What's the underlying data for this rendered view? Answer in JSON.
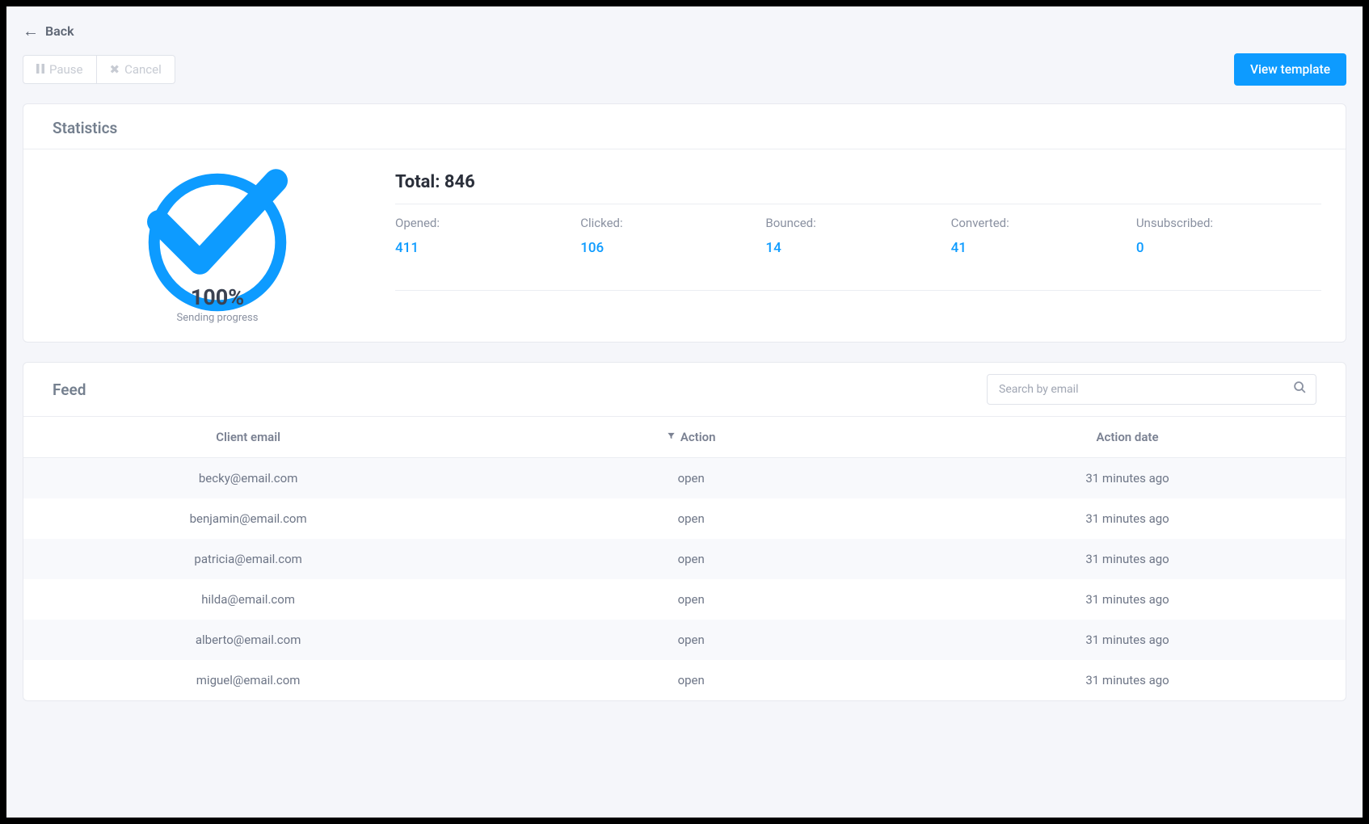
{
  "nav": {
    "back_label": "Back"
  },
  "toolbar": {
    "pause_label": "Pause",
    "cancel_label": "Cancel",
    "view_template_label": "View template"
  },
  "statistics": {
    "title": "Statistics",
    "progress_percent": "100%",
    "progress_label": "Sending progress",
    "total_label": "Total:",
    "total_value": "846",
    "metrics": [
      {
        "label": "Opened:",
        "value": "411"
      },
      {
        "label": "Clicked:",
        "value": "106"
      },
      {
        "label": "Bounced:",
        "value": "14"
      },
      {
        "label": "Converted:",
        "value": "41"
      },
      {
        "label": "Unsubscribed:",
        "value": "0"
      }
    ]
  },
  "feed": {
    "title": "Feed",
    "search_placeholder": "Search by email",
    "columns": {
      "email": "Client email",
      "action": "Action",
      "date": "Action date"
    },
    "rows": [
      {
        "email": "becky@email.com",
        "action": "open",
        "date": "31 minutes ago"
      },
      {
        "email": "benjamin@email.com",
        "action": "open",
        "date": "31 minutes ago"
      },
      {
        "email": "patricia@email.com",
        "action": "open",
        "date": "31 minutes ago"
      },
      {
        "email": "hilda@email.com",
        "action": "open",
        "date": "31 minutes ago"
      },
      {
        "email": "alberto@email.com",
        "action": "open",
        "date": "31 minutes ago"
      },
      {
        "email": "miguel@email.com",
        "action": "open",
        "date": "31 minutes ago"
      }
    ]
  }
}
